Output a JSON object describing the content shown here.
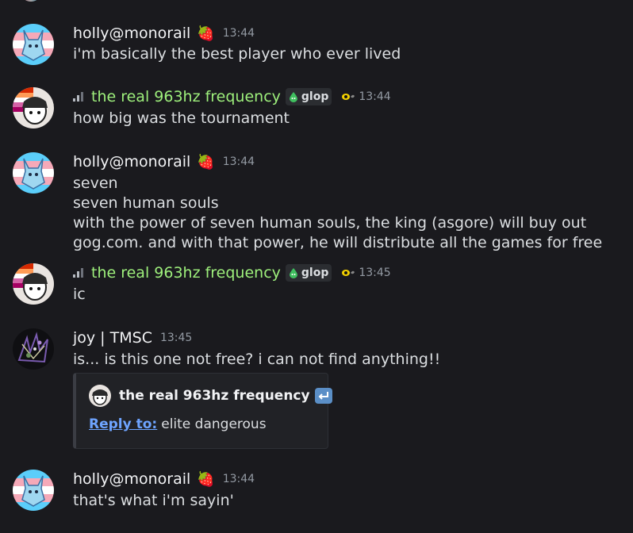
{
  "messages": [
    {
      "author": "holly@monorail",
      "badge_emoji": "🍓",
      "time": "13:44",
      "lines": [
        "i'm basically the best player who ever lived"
      ]
    },
    {
      "author": "the real 963hz frequency",
      "tag": "glop",
      "time": "13:44",
      "lines": [
        "how big was the tournament"
      ]
    },
    {
      "author": "holly@monorail",
      "badge_emoji": "🍓",
      "time": "13:44",
      "lines": [
        "seven",
        "seven human souls",
        "with the power of seven human souls, the king (asgore) will buy out",
        "gog.com. and with that power, he will distribute all the games for free"
      ]
    },
    {
      "author": "the real 963hz frequency",
      "tag": "glop",
      "time": "13:45",
      "lines": [
        "ic"
      ]
    },
    {
      "author": "joy | TMSC",
      "time": "13:45",
      "lines": [
        "is... is this one not free? i can not find anything!!"
      ],
      "embed": {
        "author": "the real 963hz frequency",
        "reply_label": "Reply to:",
        "reply_text": "elite dangerous"
      }
    },
    {
      "author": "holly@monorail",
      "badge_emoji": "🍓",
      "time": "13:44",
      "lines": [
        "that's what i'm sayin'"
      ]
    }
  ],
  "colors": {
    "background": "#1a1a1e",
    "green_name": "#9ef07c",
    "link": "#6ea4ff",
    "timestamp": "#949ba4"
  },
  "icons": [
    "signal-bars-icon",
    "slime-drop-icon",
    "eye-icon",
    "reply-arrow-icon"
  ]
}
